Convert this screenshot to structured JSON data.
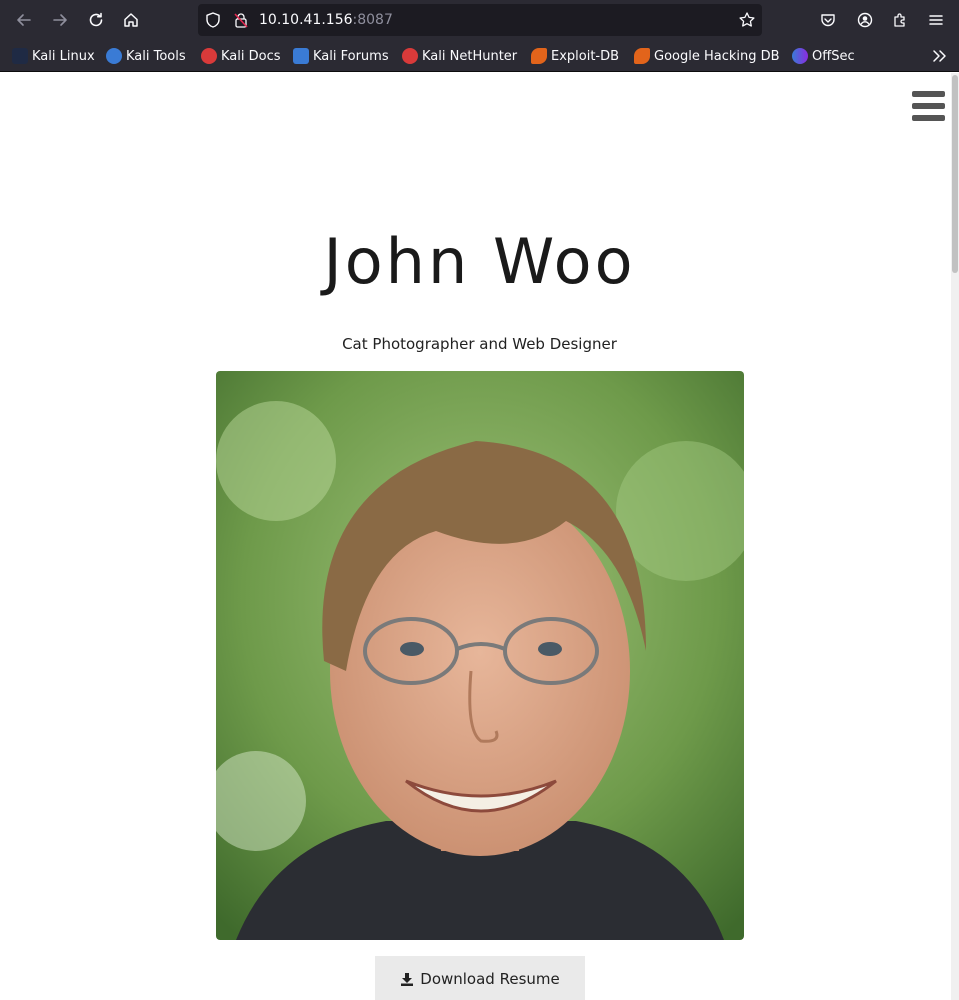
{
  "browser": {
    "url_host": "10.10.41.156",
    "url_port": ":8087",
    "bookmarks": [
      {
        "label": "Kali Linux",
        "icon": "kali-dragon-icon",
        "color": "#3a7bd5"
      },
      {
        "label": "Kali Tools",
        "icon": "kali-tools-icon",
        "color": "#3a7bd5"
      },
      {
        "label": "Kali Docs",
        "icon": "kali-docs-icon",
        "color": "#d93a3a"
      },
      {
        "label": "Kali Forums",
        "icon": "kali-forums-icon",
        "color": "#3a7bd5"
      },
      {
        "label": "Kali NetHunter",
        "icon": "kali-nethunter-icon",
        "color": "#d93a3a"
      },
      {
        "label": "Exploit-DB",
        "icon": "exploit-db-icon",
        "color": "#e2641b"
      },
      {
        "label": "Google Hacking DB",
        "icon": "ghdb-icon",
        "color": "#e2641b"
      },
      {
        "label": "OffSec",
        "icon": "offsec-icon",
        "color": "#3a7bd5"
      }
    ]
  },
  "page": {
    "name": "John Woo",
    "tagline": "Cat Photographer and Web Designer",
    "download_label": "Download Resume",
    "accent": "#555555"
  }
}
